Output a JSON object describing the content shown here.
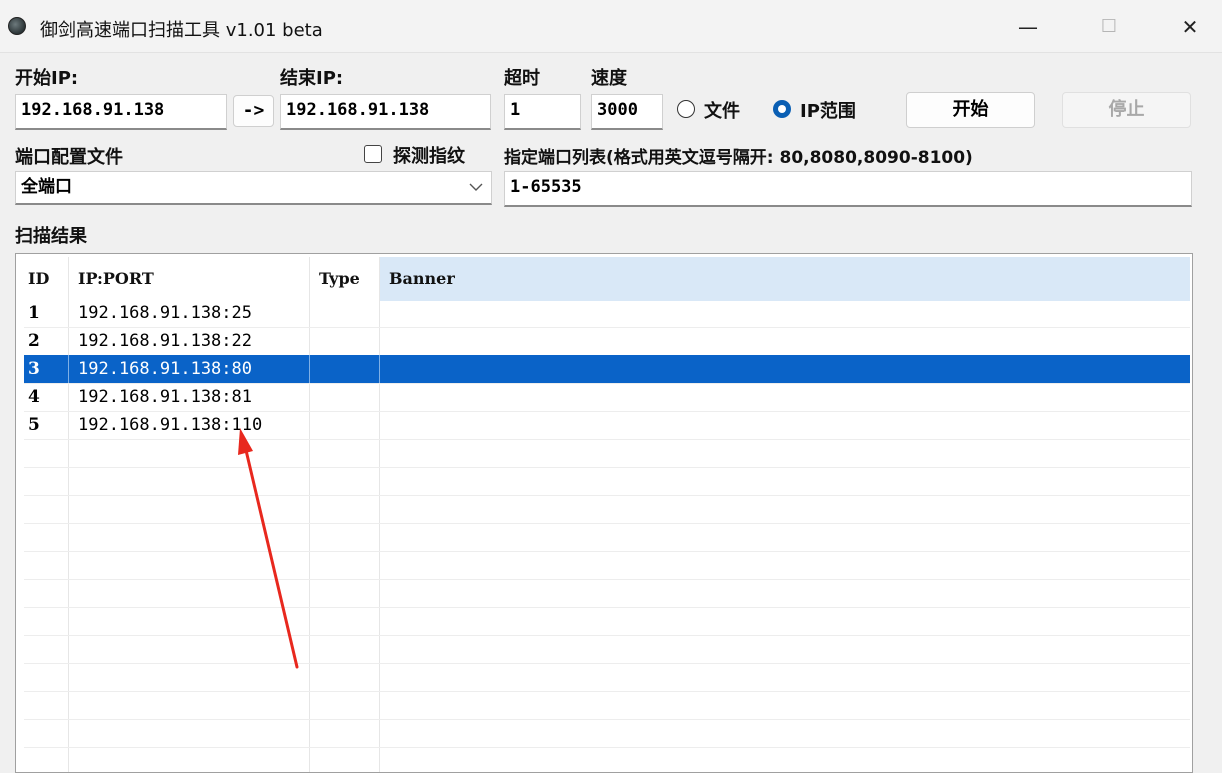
{
  "window": {
    "title": "御剑高速端口扫描工具 v1.01 beta",
    "min_glyph": "—",
    "max_glyph": "☐",
    "close_glyph": "✕"
  },
  "form": {
    "start_ip_label": "开始IP:",
    "start_ip_value": "192.168.91.138",
    "copy_button": "->",
    "end_ip_label": "结束IP:",
    "end_ip_value": "192.168.91.138",
    "timeout_label": "超时",
    "timeout_value": "1",
    "speed_label": "速度",
    "speed_value": "3000",
    "radio_file_label": "文件",
    "radio_ip_label": "IP范围",
    "selected_radio": "ip_range",
    "start_button": "开始",
    "stop_button": "停止",
    "port_config_label": "端口配置文件",
    "probe_fingerprint_label": "探测指纹",
    "probe_fingerprint_checked": false,
    "port_config_value": "全端口",
    "port_list_label": "指定端口列表(格式用英文逗号隔开: 80,8080,8090-8100)",
    "port_list_value": "1-65535"
  },
  "results": {
    "label": "扫描结果",
    "columns": [
      "ID",
      "IP:PORT",
      "Type",
      "Banner"
    ],
    "selected_index": 2,
    "rows": [
      {
        "id": "1",
        "ip_port": "192.168.91.138:25",
        "type": "",
        "banner": ""
      },
      {
        "id": "2",
        "ip_port": "192.168.91.138:22",
        "type": "",
        "banner": ""
      },
      {
        "id": "3",
        "ip_port": "192.168.91.138:80",
        "type": "",
        "banner": ""
      },
      {
        "id": "4",
        "ip_port": "192.168.91.138:81",
        "type": "",
        "banner": ""
      },
      {
        "id": "5",
        "ip_port": "192.168.91.138:110",
        "type": "",
        "banner": ""
      }
    ]
  },
  "colors": {
    "selection": "#0a63c8",
    "header_banner_bg": "#d9e8f7",
    "annotation_arrow": "#e8281e",
    "radio_selected": "#0a5fb4"
  }
}
